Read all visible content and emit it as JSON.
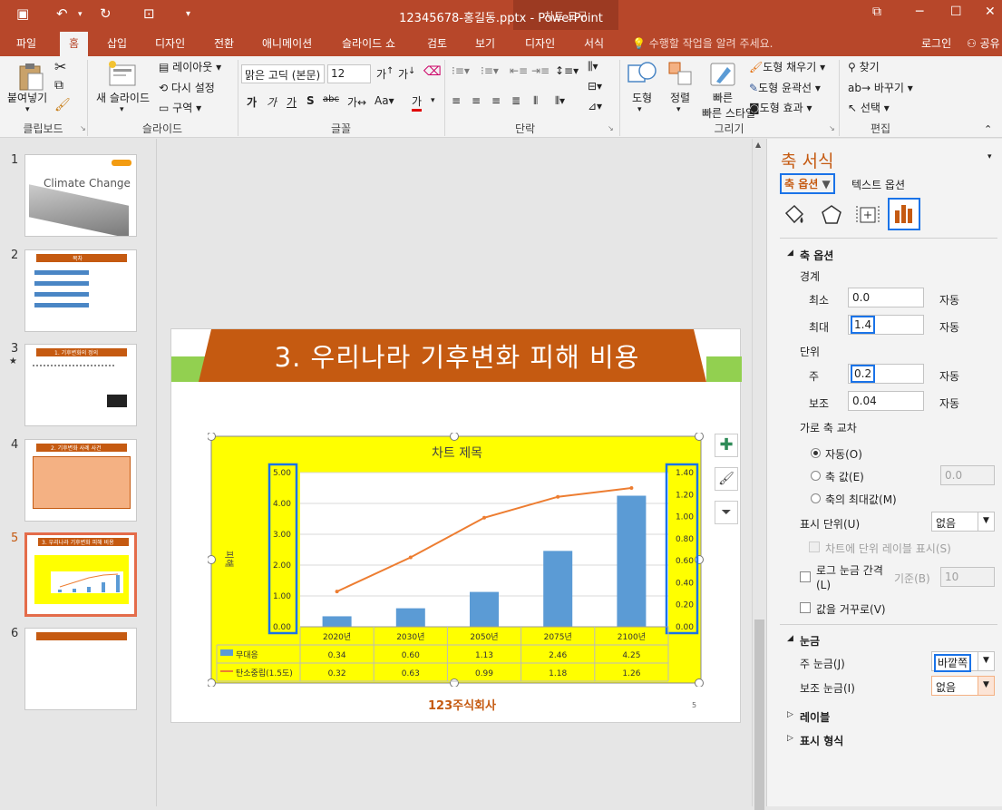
{
  "titlebar": {
    "doc_title": "12345678-홍길동.pptx - PowerPoint",
    "tool_group": "차트 도구"
  },
  "tabs": [
    "파일",
    "홈",
    "삽입",
    "디자인",
    "전환",
    "애니메이션",
    "슬라이드 쇼",
    "검토",
    "보기",
    "디자인",
    "서식"
  ],
  "tell_me": "수행할 작업을 알려 주세요.",
  "signin": "로그인",
  "share": "공유",
  "ribbon": {
    "paste": "붙여넣기",
    "new_slide": "새 슬라이드",
    "layout": "레이아웃",
    "reset": "다시 설정",
    "section": "구역",
    "font_name": "맑은 고딕 (본문)",
    "font_size": "12",
    "shape": "도형",
    "arrange": "정렬",
    "quick_style": "빠른 스타일",
    "fill": "도형 채우기",
    "outline": "도형 윤곽선",
    "effect": "도형 효과",
    "find": "찾기",
    "replace": "바꾸기",
    "select": "선택",
    "groups": [
      "클립보드",
      "슬라이드",
      "글꼴",
      "단락",
      "그리기",
      "편집"
    ]
  },
  "thumbnails": [
    {
      "num": "1",
      "title": "Climate Change"
    },
    {
      "num": "2",
      "title": "목차"
    },
    {
      "num": "3",
      "title": "1. 기후변화의 정의"
    },
    {
      "num": "4",
      "title": "2. 기후변화 사례 사건"
    },
    {
      "num": "5",
      "title": "3. 우리나라 기후변화 피해 비용"
    },
    {
      "num": "6",
      "title": ""
    }
  ],
  "slide": {
    "title": "3. 우리나라 기후변화 피해 비용",
    "page_num": "5",
    "logo_text": "123주식회사"
  },
  "chart_data": {
    "type": "bar",
    "title": "차트 제목",
    "ylabel": "피해",
    "categories": [
      "2020년",
      "2030년",
      "2050년",
      "2075년",
      "2100년"
    ],
    "series": [
      {
        "name": "무대응",
        "type": "bar",
        "axis": "left",
        "values": [
          0.34,
          0.6,
          1.13,
          2.46,
          4.25
        ],
        "color": "#5b9bd5"
      },
      {
        "name": "탄소중립(1.5도)",
        "type": "line",
        "axis": "right",
        "values": [
          0.32,
          0.63,
          0.99,
          1.18,
          1.26
        ],
        "color": "#ed7d31"
      }
    ],
    "left_axis": {
      "ylim": [
        0,
        5
      ],
      "ticks": [
        "5.00",
        "4.00",
        "3.00",
        "2.00",
        "1.00",
        "0.00"
      ]
    },
    "right_axis": {
      "ylim": [
        0,
        1.4
      ],
      "ticks": [
        "1.40",
        "1.20",
        "1.00",
        "0.80",
        "0.60",
        "0.40",
        "0.20",
        "0.00"
      ]
    },
    "data_table": [
      [
        "0.34",
        "0.60",
        "1.13",
        "2.46",
        "4.25"
      ],
      [
        "0.32",
        "0.63",
        "0.99",
        "1.18",
        "1.26"
      ]
    ],
    "grid": true,
    "legend": "data-table",
    "background": "#ffff00"
  },
  "pane": {
    "title": "축 서식",
    "tab_axis": "축 옵션",
    "tab_text": "텍스트 옵션",
    "section_axis": "축 옵션",
    "bounds": "경계",
    "min_label": "최소",
    "min_value": "0.0",
    "min_auto": "자동",
    "max_label": "최대",
    "max_value": "1.4",
    "max_auto": "자동",
    "units": "단위",
    "major_label": "주",
    "major_value": "0.2",
    "major_auto": "자동",
    "minor_label": "보조",
    "minor_value": "0.04",
    "minor_auto": "자동",
    "cross": "가로 축 교차",
    "radio_auto": "자동(O)",
    "radio_value": "축 값(E)",
    "radio_value_input": "0.0",
    "radio_max": "축의 최대값(M)",
    "display_units": "표시 단위(U)",
    "display_units_value": "없음",
    "show_unit_label": "차트에 단위 레이블 표시(S)",
    "log_scale": "로그 눈금 간격(L)",
    "base_label": "기준(B)",
    "base_value": "10",
    "reverse": "값을 거꾸로(V)",
    "section_ticks": "눈금",
    "major_tick": "주 눈금(J)",
    "major_tick_value": "바깥쪽",
    "minor_tick": "보조 눈금(I)",
    "minor_tick_value": "없음",
    "section_labels": "레이블",
    "section_number": "표시 형식"
  }
}
